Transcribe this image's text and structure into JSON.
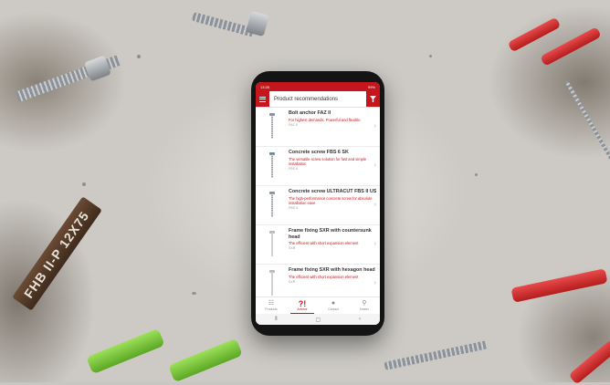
{
  "status_bar": {
    "time": "13:35",
    "battery": "99%"
  },
  "header": {
    "title": "Product recommendations"
  },
  "products": [
    {
      "name": "Bolt anchor FAZ II",
      "description": "For highest demands. Powerful and flexible.",
      "code": "FAZ II"
    },
    {
      "name": "Concrete screw FBS 6 SK",
      "description": "The versatile screw solution for fast and simple installation",
      "code": "FBS 6"
    },
    {
      "name": "Concrete screw ULTRACUT FBS II US",
      "description": "The high-performance concrete screw for absolute installation ease",
      "code": "FBS II"
    },
    {
      "name": "Frame fixing SXR with countersunk head",
      "description": "The efficient with short expansion element",
      "code": "SXR"
    },
    {
      "name": "Frame fixing SXR with hexagon head",
      "description": "The efficient with short expansion element",
      "code": "SXR"
    }
  ],
  "tabs": [
    {
      "label": "Products",
      "icon": "grid-icon"
    },
    {
      "label": "Advisor",
      "icon": "advisor-icon"
    },
    {
      "label": "Contact",
      "icon": "chat-icon"
    },
    {
      "label": "Dealer",
      "icon": "location-pin-icon"
    }
  ],
  "decor": {
    "anchor_box_text": "FHB II-P 12X75"
  },
  "colors": {
    "accent": "#c4161c"
  }
}
